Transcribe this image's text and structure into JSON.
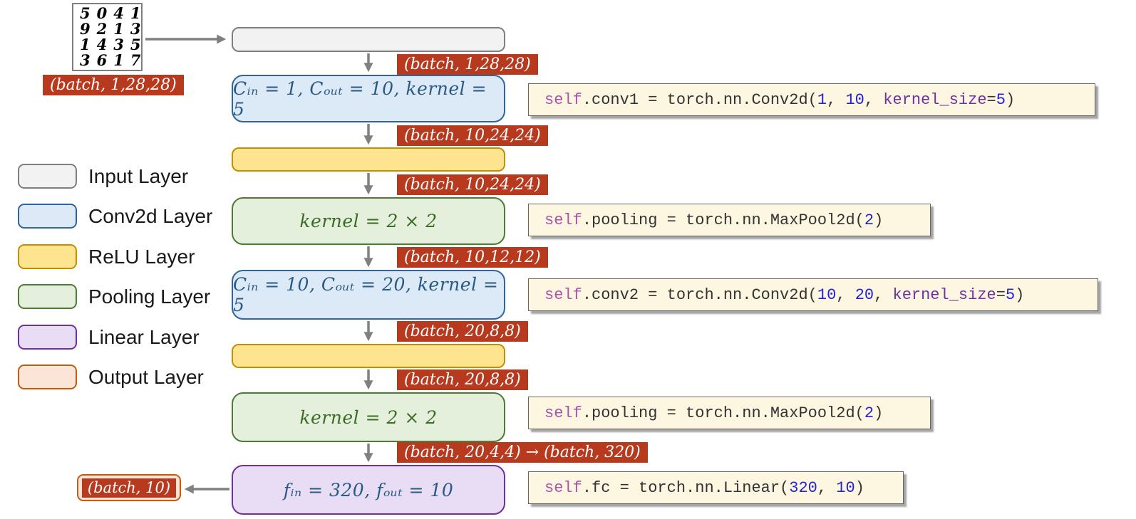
{
  "palette": {
    "badge_bg": "#B7391E",
    "badge_text": "#FFFFFF",
    "arrow": "#808080",
    "input_fill": "#F2F2F2",
    "input_border": "#7F7F7F",
    "conv_fill": "#DCE9F7",
    "conv_border": "#31659C",
    "conv_text": "#295A85",
    "relu_fill": "#FFE48F",
    "relu_border": "#BF9000",
    "pool_fill": "#E4F0DC",
    "pool_border": "#4E7A35",
    "pool_text": "#3C6B28",
    "linear_fill": "#E9DCF5",
    "linear_border": "#7030A0",
    "linear_text": "#295A85",
    "output_fill": "#FBE5D6",
    "output_border": "#C55A11",
    "code_bg": "#FDF6E0",
    "code_self": "#A855A8",
    "code_number": "#2222DD",
    "code_keyword_arg": "#7030A0",
    "code_plain": "#333333"
  },
  "input_image": {
    "rows": [
      "5041",
      "9213",
      "1435",
      "3617"
    ],
    "shape_label": "(batch, 1,28,28)"
  },
  "diagram": {
    "layers": [
      {
        "id": "input",
        "type": "input",
        "label": ""
      },
      {
        "id": "conv1",
        "type": "conv",
        "label": "Cᵢₙ = 1, Cₒᵤₜ = 10, kernel = 5"
      },
      {
        "id": "relu1",
        "type": "relu",
        "label": ""
      },
      {
        "id": "pool1",
        "type": "pool",
        "label": "kernel = 2 × 2"
      },
      {
        "id": "conv2",
        "type": "conv",
        "label": "Cᵢₙ = 10, Cₒᵤₜ = 20, kernel = 5"
      },
      {
        "id": "relu2",
        "type": "relu",
        "label": ""
      },
      {
        "id": "pool2",
        "type": "pool",
        "label": "kernel = 2 × 2"
      },
      {
        "id": "fc",
        "type": "linear",
        "label": "fᵢₙ = 320, fₒᵤₜ = 10"
      }
    ],
    "shape_badges": {
      "after_input": "(batch, 1,28,28)",
      "after_conv1": "(batch, 10,24,24)",
      "after_relu1": "(batch, 10,24,24)",
      "after_pool1": "(batch, 10,12,12)",
      "after_conv2": "(batch, 20,8,8)",
      "after_relu2": "(batch, 20,8,8)",
      "after_pool2": "(batch, 20,4,4) → (batch, 320)",
      "output": "(batch, 10)"
    }
  },
  "legend": {
    "items": [
      {
        "label": "Input Layer",
        "fill": "#F2F2F2",
        "border": "#7F7F7F"
      },
      {
        "label": "Conv2d Layer",
        "fill": "#DCE9F7",
        "border": "#31659C"
      },
      {
        "label": "ReLU Layer",
        "fill": "#FFE48F",
        "border": "#BF9000"
      },
      {
        "label": "Pooling Layer",
        "fill": "#E4F0DC",
        "border": "#4E7A35"
      },
      {
        "label": "Linear Layer",
        "fill": "#E9DCF5",
        "border": "#7030A0"
      },
      {
        "label": "Output Layer",
        "fill": "#FBE5D6",
        "border": "#C55A11"
      }
    ]
  },
  "code": {
    "conv1": [
      {
        "c": "self",
        "t": "self"
      },
      {
        "c": "plain",
        "t": ".conv1 = torch.nn.Conv2d("
      },
      {
        "c": "num",
        "t": "1"
      },
      {
        "c": "plain",
        "t": ", "
      },
      {
        "c": "num",
        "t": "10"
      },
      {
        "c": "plain",
        "t": ", "
      },
      {
        "c": "arg",
        "t": "kernel_size"
      },
      {
        "c": "plain",
        "t": "="
      },
      {
        "c": "num",
        "t": "5"
      },
      {
        "c": "plain",
        "t": ")"
      }
    ],
    "pool1": [
      {
        "c": "self",
        "t": "self"
      },
      {
        "c": "plain",
        "t": ".pooling = torch.nn.MaxPool2d("
      },
      {
        "c": "num",
        "t": "2"
      },
      {
        "c": "plain",
        "t": ")"
      }
    ],
    "conv2": [
      {
        "c": "self",
        "t": "self"
      },
      {
        "c": "plain",
        "t": ".conv2 = torch.nn.Conv2d("
      },
      {
        "c": "num",
        "t": "10"
      },
      {
        "c": "plain",
        "t": ", "
      },
      {
        "c": "num",
        "t": "20"
      },
      {
        "c": "plain",
        "t": ", "
      },
      {
        "c": "arg",
        "t": "kernel_size"
      },
      {
        "c": "plain",
        "t": "="
      },
      {
        "c": "num",
        "t": "5"
      },
      {
        "c": "plain",
        "t": ")"
      }
    ],
    "pool2": [
      {
        "c": "self",
        "t": "self"
      },
      {
        "c": "plain",
        "t": ".pooling = torch.nn.MaxPool2d("
      },
      {
        "c": "num",
        "t": "2"
      },
      {
        "c": "plain",
        "t": ")"
      }
    ],
    "fc": [
      {
        "c": "self",
        "t": "self"
      },
      {
        "c": "plain",
        "t": ".fc = torch.nn.Linear("
      },
      {
        "c": "num",
        "t": "320"
      },
      {
        "c": "plain",
        "t": ", "
      },
      {
        "c": "num",
        "t": "10"
      },
      {
        "c": "plain",
        "t": ")"
      }
    ]
  }
}
